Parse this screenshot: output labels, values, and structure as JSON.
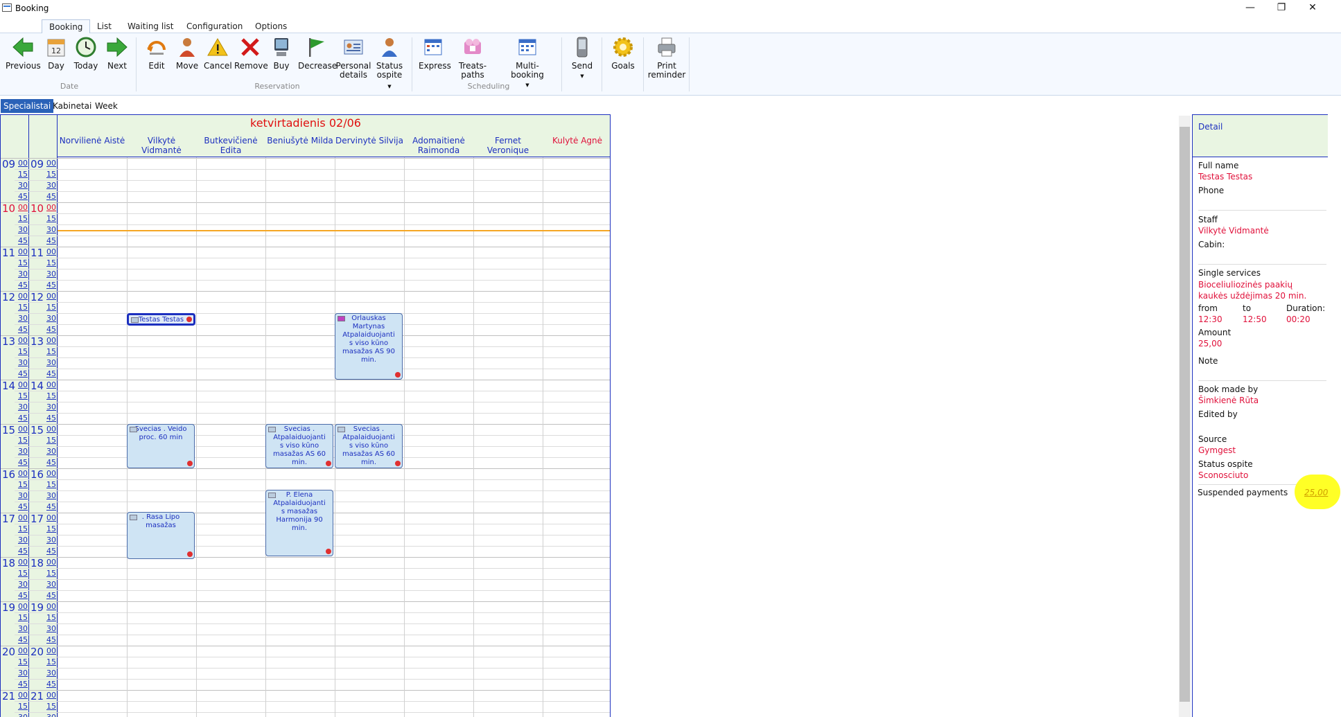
{
  "window": {
    "title": "Booking",
    "minimize": "—",
    "restore": "❐",
    "close": "✕"
  },
  "menu_tabs": [
    "Booking",
    "List",
    "Waiting list",
    "Configuration",
    "Options"
  ],
  "ribbon": {
    "buttons": [
      {
        "label": "Previous",
        "icon": "arrow-left-icon"
      },
      {
        "label": "Day",
        "icon": "calendar-day-icon"
      },
      {
        "label": "Today",
        "icon": "clock-icon"
      },
      {
        "label": "Next",
        "icon": "arrow-right-icon"
      },
      {
        "label": "Edit",
        "icon": "edit-icon"
      },
      {
        "label": "Move",
        "icon": "move-person-icon"
      },
      {
        "label": "Cancel",
        "icon": "warning-icon"
      },
      {
        "label": "Remove",
        "icon": "remove-x-icon"
      },
      {
        "label": "Buy",
        "icon": "computer-icon"
      },
      {
        "label": "Decrease",
        "icon": "flag-icon"
      },
      {
        "label": "Personal details",
        "icon": "personal-details-icon"
      },
      {
        "label": "Status ospite",
        "icon": "person-status-icon"
      },
      {
        "label": "Express",
        "icon": "express-icon"
      },
      {
        "label": "Treats-paths",
        "icon": "treats-paths-icon"
      },
      {
        "label": "Multi-booking",
        "icon": "multi-booking-icon"
      },
      {
        "label": "Send",
        "icon": "phone-icon"
      },
      {
        "label": "Goals",
        "icon": "gear-goals-icon"
      },
      {
        "label": "Print reminder",
        "icon": "printer-icon"
      }
    ],
    "groups": [
      "Date",
      "Reservation",
      "Scheduling"
    ]
  },
  "view_tabs": [
    "Specialistai",
    "Kabinetai",
    "Week"
  ],
  "calendar": {
    "date_title": "ketvirtadienis 02/06",
    "staff": [
      "Norvilienė Aistė",
      "Vilkytė Vidmantė",
      "Butkevičienė Edita",
      "Beniušytė Milda",
      "Dervinytė Silvija",
      "Adomaitienė Raimonda",
      "Fernet Veronique",
      "Kulytė Agnė"
    ],
    "hours": [
      "09",
      "10",
      "11",
      "12",
      "13",
      "14",
      "15",
      "16",
      "17",
      "18",
      "19",
      "20",
      "21"
    ],
    "minutes": [
      "00",
      "15",
      "30",
      "45"
    ],
    "current_hour": "10",
    "appointments": [
      {
        "text": "Testas Testas",
        "selected": true
      },
      {
        "text": "Orlauskas Martynas Atpalaiduojanti s viso kūno masažas AS 90 min."
      },
      {
        "text": "Svecias . Veido proc. 60 min"
      },
      {
        "text": "Svecias . Atpalaiduojanti s viso kūno masažas AS 60 min."
      },
      {
        "text": "Svecias . Atpalaiduojanti s viso kūno masažas AS 60 min."
      },
      {
        "text": "P. Elena Atpalaiduojanti s masažas Harmonija 90 min."
      },
      {
        "text": ". Rasa Lipo masažas"
      }
    ]
  },
  "detail": {
    "header": "Detail",
    "full_name_label": "Full name",
    "full_name": "Testas Testas",
    "phone_label": "Phone",
    "staff_label": "Staff",
    "staff": "Vilkytė Vidmantė",
    "cabin_label": "Cabin:",
    "services_label": "Single services",
    "services": "Bioceliuliozinės paakių kaukės uždėjimas 20 min.",
    "from_label": "from",
    "from": "12:30",
    "to_label": "to",
    "to": "12:50",
    "duration_label": "Duration:",
    "duration": "00:20",
    "amount_label": "Amount",
    "amount": "25,00",
    "note_label": "Note",
    "book_made_by_label": "Book made by",
    "book_made_by": "Šimkienė Rūta",
    "edited_by_label": "Edited by",
    "source_label": "Source",
    "source": "Gymgest",
    "status_label": "Status ospite",
    "status": "Sconosciuto",
    "suspended_label": "Suspended payments",
    "suspended": "25,00"
  },
  "colors": {
    "accent": "#1c2fbf",
    "red": "#e0103a",
    "highlight": "#ffff26",
    "now_line": "#f5a623"
  }
}
